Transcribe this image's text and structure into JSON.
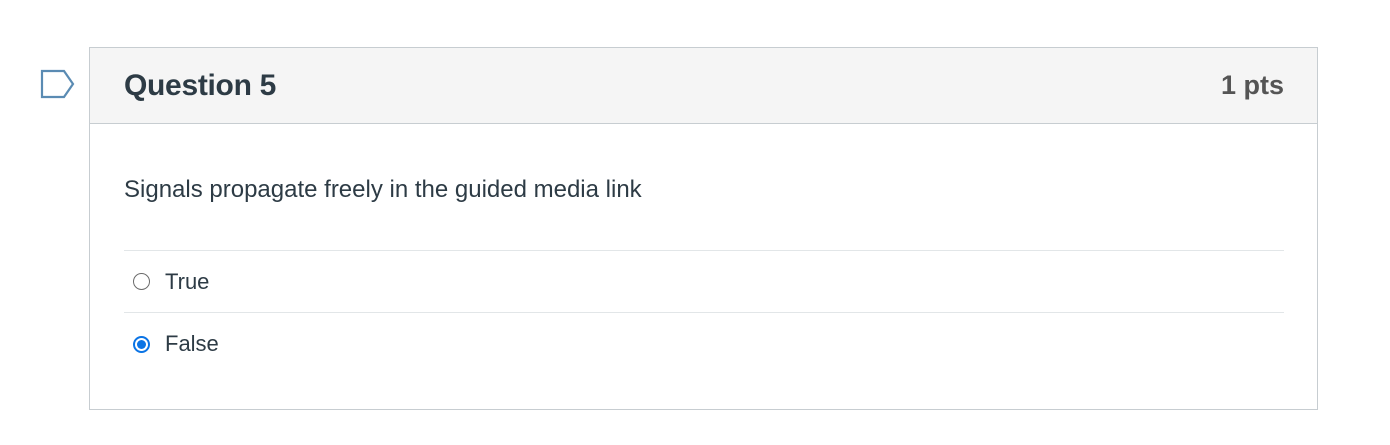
{
  "question": {
    "title": "Question 5",
    "points": "1 pts",
    "text": "Signals propagate freely in the guided media link",
    "flag_icon": "bookmark-flag-icon",
    "answers": [
      {
        "label": "True",
        "selected": false
      },
      {
        "label": "False",
        "selected": true
      }
    ]
  },
  "colors": {
    "accent": "#0b74e5",
    "header_bg": "#f5f5f5",
    "border": "#c7cdd1",
    "flag": "#5a8bb3",
    "text": "#2d3b45"
  }
}
